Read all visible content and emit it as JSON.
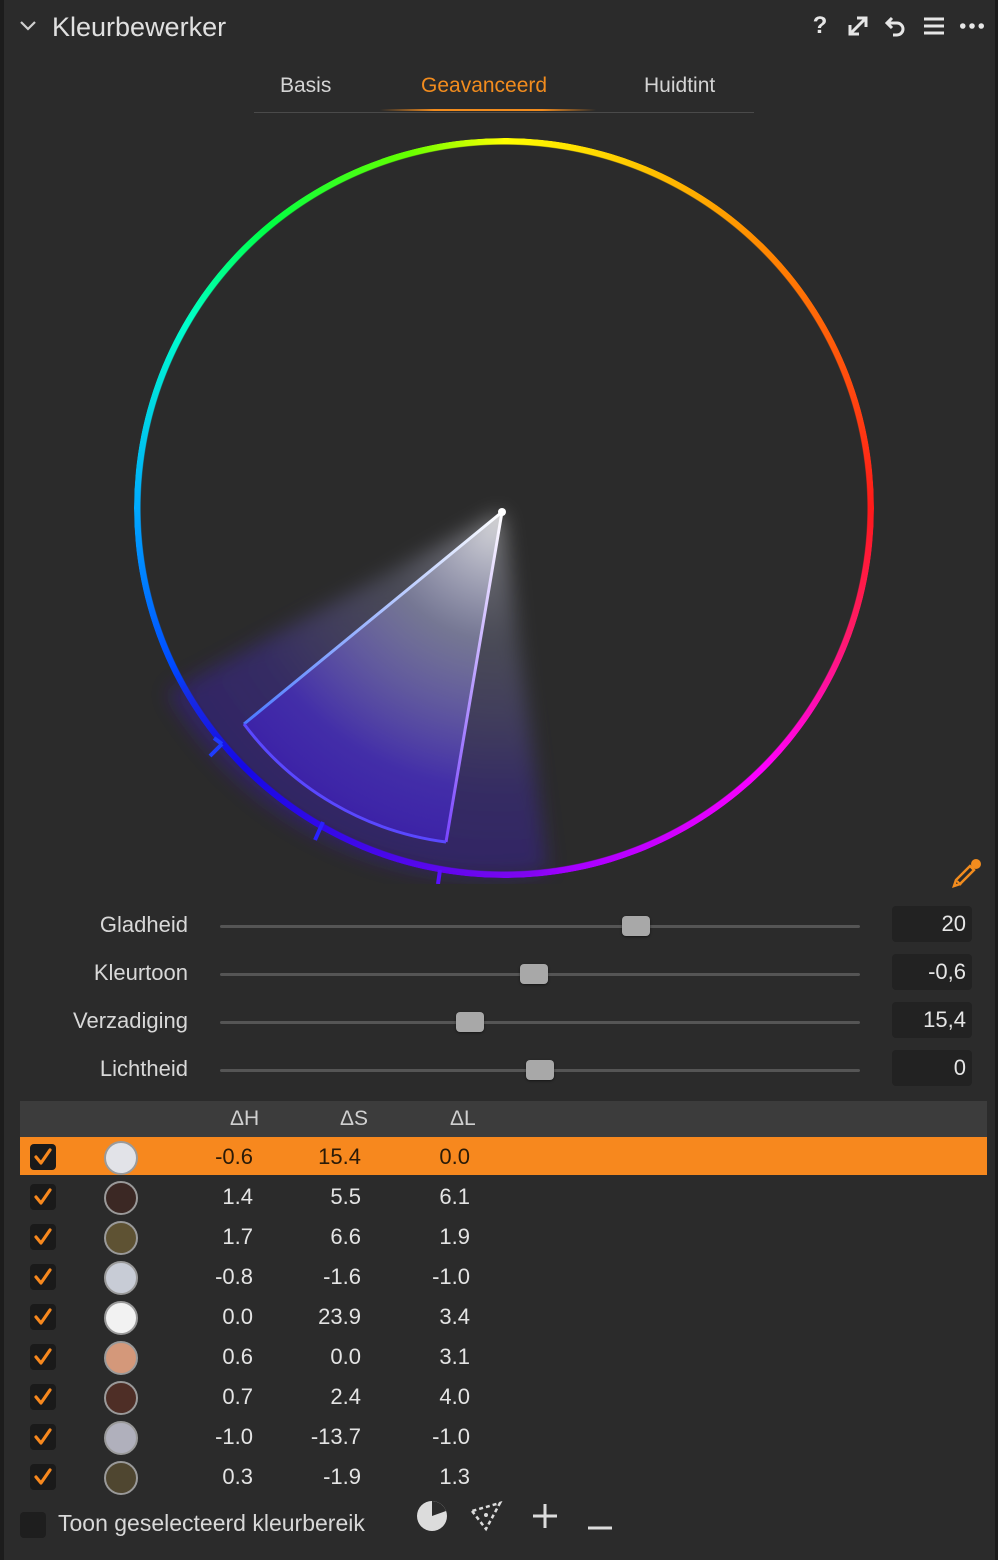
{
  "panel": {
    "title": "Kleurbewerker",
    "header_icons": [
      "help-icon",
      "expand-icon",
      "reset-icon",
      "presets-icon",
      "more-icon"
    ]
  },
  "tabs": [
    {
      "label": "Basis",
      "active": false
    },
    {
      "label": "Geavanceerd",
      "active": true
    },
    {
      "label": "Huidtint",
      "active": false
    }
  ],
  "colors": {
    "accent": "#f7881e",
    "background": "#2b2b2b"
  },
  "sliders": [
    {
      "label": "Gladheid",
      "value": "20",
      "level": 0.65
    },
    {
      "label": "Kleurtoon",
      "value": "-0,6",
      "level": 0.49
    },
    {
      "label": "Verzadiging",
      "value": "15,4",
      "level": 0.39
    },
    {
      "label": "Lichtheid",
      "value": "0",
      "level": 0.5
    }
  ],
  "table": {
    "headers": [
      "ΔH",
      "ΔS",
      "ΔL"
    ],
    "rows": [
      {
        "checked": true,
        "color": "#e2e3e8",
        "dh": "-0.6",
        "ds": "15.4",
        "dl": "0.0",
        "selected": true
      },
      {
        "checked": true,
        "color": "#3b2824",
        "dh": "1.4",
        "ds": "5.5",
        "dl": "6.1"
      },
      {
        "checked": true,
        "color": "#5e5233",
        "dh": "1.7",
        "ds": "6.6",
        "dl": "1.9"
      },
      {
        "checked": true,
        "color": "#c8ccd6",
        "dh": "-0.8",
        "ds": "-1.6",
        "dl": "-1.0"
      },
      {
        "checked": true,
        "color": "#f2f2f2",
        "dh": "0.0",
        "ds": "23.9",
        "dl": "3.4"
      },
      {
        "checked": true,
        "color": "#d4987a",
        "dh": "0.6",
        "ds": "0.0",
        "dl": "3.1"
      },
      {
        "checked": true,
        "color": "#4e2e26",
        "dh": "0.7",
        "ds": "2.4",
        "dl": "4.0"
      },
      {
        "checked": true,
        "color": "#b0b0bc",
        "dh": "-1.0",
        "ds": "-13.7",
        "dl": "-1.0"
      },
      {
        "checked": true,
        "color": "#4f4630",
        "dh": "0.3",
        "ds": "-1.9",
        "dl": "1.3"
      }
    ]
  },
  "footer": {
    "show_range_label": "Toon geselecteerd kleurbereik",
    "show_range_checked": false,
    "icons": [
      "pie-range-icon",
      "segment-range-icon",
      "add-icon",
      "remove-icon"
    ]
  }
}
